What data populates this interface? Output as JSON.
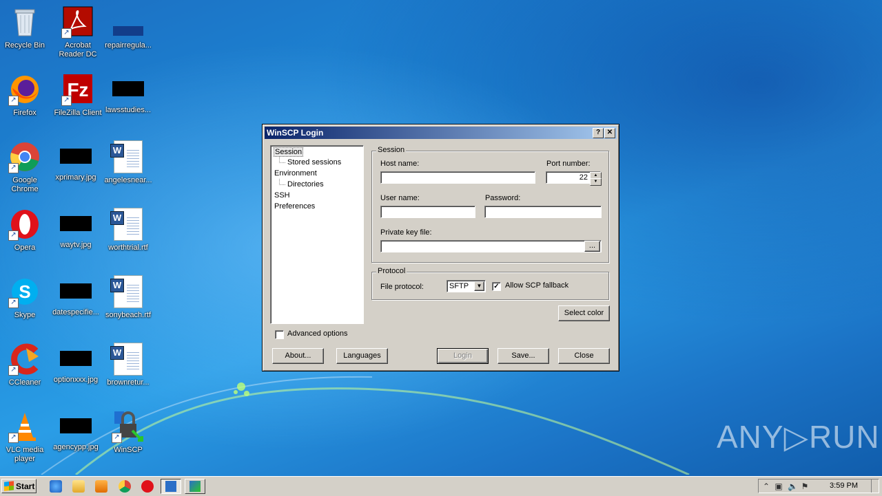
{
  "desktop": {
    "icons": [
      {
        "label": "Recycle Bin"
      },
      {
        "label": "Acrobat\nReader DC"
      },
      {
        "label": "repairregula..."
      },
      {
        "label": "Firefox"
      },
      {
        "label": "FileZilla Client"
      },
      {
        "label": "lawsstudies..."
      },
      {
        "label": "Google\nChrome"
      },
      {
        "label": "xprimary.jpg"
      },
      {
        "label": "angelesnear..."
      },
      {
        "label": "Opera"
      },
      {
        "label": "waytv.jpg"
      },
      {
        "label": "worthtrial.rtf"
      },
      {
        "label": "Skype"
      },
      {
        "label": "datespecifie..."
      },
      {
        "label": "sonybeach.rtf"
      },
      {
        "label": "CCleaner"
      },
      {
        "label": "optionxxx.jpg"
      },
      {
        "label": "brownretur..."
      },
      {
        "label": "VLC media\nplayer"
      },
      {
        "label": "agencypp.jpg"
      },
      {
        "label": "WinSCP"
      }
    ]
  },
  "dialog": {
    "title": "WinSCP Login",
    "help_btn": "?",
    "close_btn": "✕",
    "tree": [
      "Session",
      "Stored sessions",
      "Environment",
      "Directories",
      "SSH",
      "Preferences"
    ],
    "session": {
      "group_title": "Session",
      "host_label": "Host name:",
      "host_value": "",
      "port_label": "Port number:",
      "port_value": "22",
      "user_label": "User name:",
      "user_value": "",
      "password_label": "Password:",
      "password_value": "",
      "key_label": "Private key file:",
      "key_value": "",
      "browse_label": "..."
    },
    "protocol": {
      "group_title": "Protocol",
      "file_protocol_label": "File protocol:",
      "file_protocol_value": "SFTP",
      "scp_fallback_label": "Allow SCP fallback",
      "scp_fallback_checked": true
    },
    "select_color": "Select color",
    "advanced_options": "Advanced options",
    "advanced_checked": false,
    "buttons": {
      "about": "About...",
      "languages": "Languages",
      "login": "Login",
      "save": "Save...",
      "close": "Close"
    }
  },
  "taskbar": {
    "start_label": "Start",
    "clock": "3:59 PM"
  },
  "watermark": "ANY▷RUN",
  "colors": {
    "title_gradient_start": "#0a246a",
    "title_gradient_end": "#a6caf0",
    "dialog_face": "#d4d0c8"
  }
}
